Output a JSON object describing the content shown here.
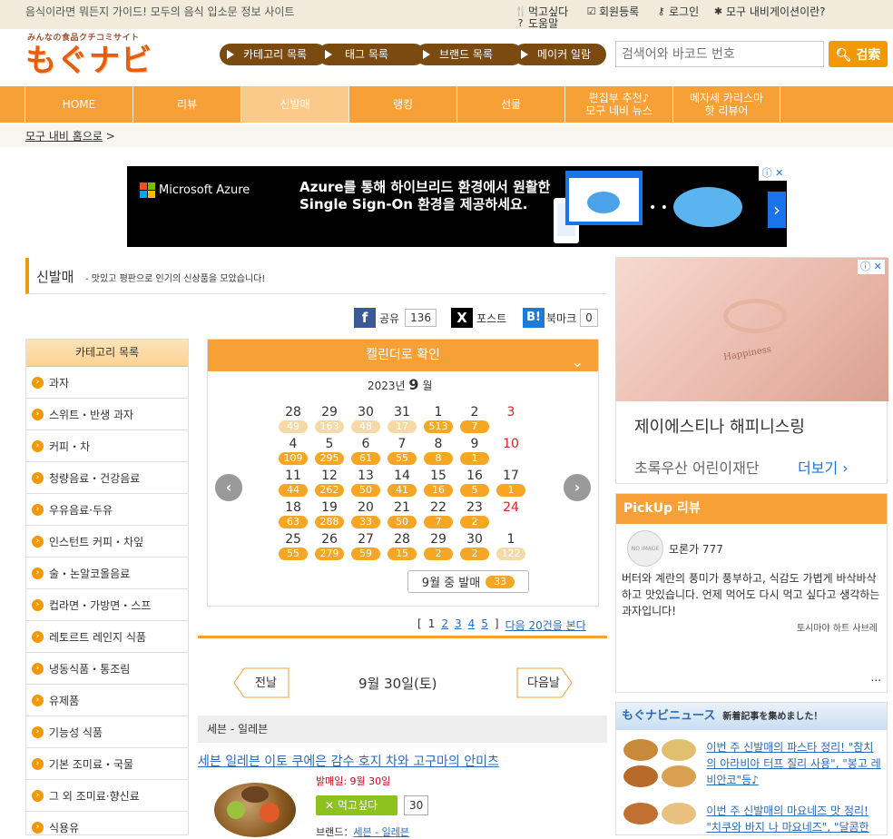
{
  "topbar": {
    "tagline": "음식이라면 뭐든지 가이드! 모두의 음식 입소문 정보 사이트",
    "links": {
      "want_eat": "먹고싶다",
      "register": "회원등록",
      "login": "로그인",
      "about": "모구 내비게이션이란?",
      "help": "도움말"
    }
  },
  "logo": {
    "sub": "みんなの食品クチコミサイト",
    "main": "もぐナビ"
  },
  "header_pills": [
    "카테고리 목록",
    "태그 목록",
    "브랜드 목록",
    "메이커 일람"
  ],
  "search": {
    "placeholder": "검색어와 바코드 번호",
    "button": "검索"
  },
  "nav": [
    "HOME",
    "리뷰",
    "신발매",
    "랭킹",
    "선물",
    "편집부 추천♪\n모구 네비 뉴스",
    "메자세 카리스마\n핫 리뷰어"
  ],
  "breadcrumb": {
    "home": "모구 내비 홈으로",
    "sep": ">"
  },
  "ad": {
    "brand": "Microsoft Azure",
    "line1": "Azure를 통해 하이브리드 환경에서 원활한",
    "line2": "Single Sign-On 환경을 제공하세요.",
    "info": "ⓘ ✕"
  },
  "section": {
    "title": "신발매",
    "desc": "- 맛있고 평판으로 인기의 신상품을 모았습니다!"
  },
  "share": [
    {
      "label": "공유",
      "count": "136",
      "icon": "f",
      "color": "#3b5998"
    },
    {
      "label": "포스트",
      "count": "",
      "icon": "X",
      "color": "#000000"
    },
    {
      "label": "북마크",
      "count": "0",
      "icon": "B!",
      "color": "#1d7bd8"
    }
  ],
  "categories": {
    "title": "카테고리 목록",
    "items": [
      "과자",
      "스위트・반생 과자",
      "커피・차",
      "청량음료・건강음료",
      "우유음료·두유",
      "인스턴트 커피・차잎",
      "술・논알코올음료",
      "컵라면・가방면・스프",
      "레토르트 레인지 식품",
      "냉동식품・통조림",
      "유제품",
      "기능성 식품",
      "기본 조미료・국물",
      "그 외 조미료·향신료",
      "식용유"
    ]
  },
  "calendar": {
    "header": "캘린더로 확인",
    "year": "2023년",
    "month": "9",
    "month_suffix": "월",
    "weeks": [
      [
        {
          "d": "28",
          "c": "49",
          "f": true
        },
        {
          "d": "29",
          "c": "163",
          "f": true
        },
        {
          "d": "30",
          "c": "48",
          "f": true
        },
        {
          "d": "31",
          "c": "17",
          "f": true
        },
        {
          "d": "1",
          "c": "513"
        },
        {
          "d": "2",
          "c": "7"
        },
        {
          "d": "3",
          "c": "",
          "sun": true
        }
      ],
      [
        {
          "d": "4",
          "c": "109"
        },
        {
          "d": "5",
          "c": "295"
        },
        {
          "d": "6",
          "c": "61"
        },
        {
          "d": "7",
          "c": "55"
        },
        {
          "d": "8",
          "c": "8"
        },
        {
          "d": "9",
          "c": "1"
        },
        {
          "d": "10",
          "c": "",
          "sun": true
        }
      ],
      [
        {
          "d": "11",
          "c": "44"
        },
        {
          "d": "12",
          "c": "262"
        },
        {
          "d": "13",
          "c": "50"
        },
        {
          "d": "14",
          "c": "41"
        },
        {
          "d": "15",
          "c": "16"
        },
        {
          "d": "16",
          "c": "5"
        },
        {
          "d": "17",
          "c": "1"
        }
      ],
      [
        {
          "d": "18",
          "c": "63"
        },
        {
          "d": "19",
          "c": "288"
        },
        {
          "d": "20",
          "c": "33"
        },
        {
          "d": "21",
          "c": "50"
        },
        {
          "d": "22",
          "c": "7"
        },
        {
          "d": "23",
          "c": "2"
        },
        {
          "d": "24",
          "c": "",
          "sun": true
        }
      ],
      [
        {
          "d": "25",
          "c": "55"
        },
        {
          "d": "26",
          "c": "279"
        },
        {
          "d": "27",
          "c": "59"
        },
        {
          "d": "28",
          "c": "15"
        },
        {
          "d": "29",
          "c": "2"
        },
        {
          "d": "30",
          "c": "2"
        },
        {
          "d": "1",
          "c": "122",
          "f": true
        }
      ]
    ],
    "month_release_label": "9월 중 발매",
    "month_release_count": "33"
  },
  "pager": {
    "open": "[",
    "current": "1",
    "pages": [
      "2",
      "3",
      "4",
      "5"
    ],
    "close": "]",
    "next": "다음 20건을 본다"
  },
  "daynav": {
    "prev": "전날",
    "date": "9월 30일(토)",
    "next": "다음날"
  },
  "product": {
    "store": "세븐 - 일레븐",
    "title": "세븐 일레븐 이토 쿠에은 감수 호지 차와 고구마의 안미츠",
    "release": "발매일: 9월 30일",
    "want_label": "먹고싶다",
    "want_count": "30",
    "brand_label": "브랜드：",
    "brand_link": "세븐 - 일레븐"
  },
  "side_ad": {
    "title": "제이에스티나 해피니스링",
    "sponsor": "초록우산 어린이재단",
    "more": "더보기 ›",
    "ring_text": "Happiness",
    "info": "ⓘ ✕"
  },
  "pickup": {
    "title": "PickUp 리뷰",
    "avatar": "NO IMAGE",
    "user": "모론가 777",
    "body": "버터와 계란의 풍미가 풍부하고, 식감도 가볍게 바삭바삭하고 맛있습니다. 언제 먹어도 다시 먹고 싶다고 생각하는 과자입니다!",
    "product": "토시마야 하트 사브레",
    "more": "..."
  },
  "news": {
    "title": "もぐナビニュース",
    "subtitle": "新着記事を集めました！",
    "items": [
      "이번 주 신발매의 파스타 정리! \"참치의 아라비아 터프 질리 사용\", \"봉고 레비안코\"등♪",
      "이번 주 신발매의 마요네즈 맛 정리! \"치쿠와 바지 나 마요네즈\", \"달콤한"
    ]
  }
}
